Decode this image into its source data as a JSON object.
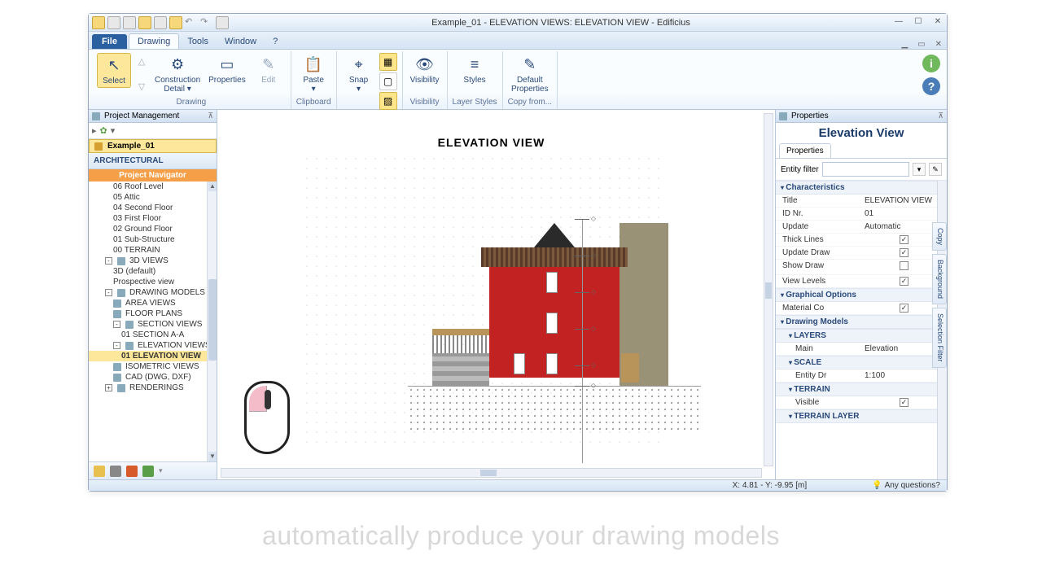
{
  "titlebar": {
    "text": "Example_01  -  ELEVATION VIEWS: ELEVATION VIEW - Edificius"
  },
  "menu": {
    "file": "File",
    "tabs": [
      "Drawing",
      "Tools",
      "Window",
      "?"
    ],
    "active": 0
  },
  "ribbon": {
    "groups": [
      {
        "label": "Drawing",
        "items": [
          {
            "label": "Select",
            "icon": "↖",
            "selected": true
          },
          {
            "label": "Construction\nDetail ▾",
            "icon": "⚙"
          },
          {
            "label": "Properties",
            "icon": "▭"
          },
          {
            "label": "Edit",
            "icon": "✎"
          }
        ]
      },
      {
        "label": "Clipboard",
        "items": [
          {
            "label": "Paste\n▾",
            "icon": "📋"
          }
        ]
      },
      {
        "label": "Snap",
        "items": [
          {
            "label": "Snap\n▾",
            "icon": "⌖"
          }
        ]
      },
      {
        "label": "Visibility",
        "items": [
          {
            "label": "Visibility",
            "icon": "👁"
          }
        ]
      },
      {
        "label": "Layer Styles",
        "items": [
          {
            "label": "Styles",
            "icon": "≡"
          }
        ]
      },
      {
        "label": "Copy from...",
        "items": [
          {
            "label": "Default\nProperties",
            "icon": "✎"
          }
        ]
      }
    ]
  },
  "projectPanel": {
    "title": "Project Management",
    "projectName": "Example_01",
    "sectionHeader": "ARCHITECTURAL",
    "navigatorHeader": "Project Navigator",
    "tree": [
      {
        "label": "06 Roof Level",
        "lvl": 1
      },
      {
        "label": "05 Attic",
        "lvl": 1
      },
      {
        "label": "04 Second Floor",
        "lvl": 1
      },
      {
        "label": "03 First Floor",
        "lvl": 1
      },
      {
        "label": "02 Ground Floor",
        "lvl": 1
      },
      {
        "label": "01 Sub-Structure",
        "lvl": 1
      },
      {
        "label": "00 TERRAIN",
        "lvl": 1
      },
      {
        "label": "3D VIEWS",
        "lvl": 0,
        "hdr": true,
        "exp": "-"
      },
      {
        "label": "3D (default)",
        "lvl": 1
      },
      {
        "label": "Prospective view",
        "lvl": 1
      },
      {
        "label": "DRAWING MODELS",
        "lvl": 0,
        "hdr": true,
        "exp": "-"
      },
      {
        "label": "AREA VIEWS",
        "lvl": 1,
        "hdr": true
      },
      {
        "label": "FLOOR PLANS",
        "lvl": 1,
        "hdr": true
      },
      {
        "label": "SECTION VIEWS",
        "lvl": 1,
        "hdr": true,
        "exp": "-"
      },
      {
        "label": "01 SECTION  A-A",
        "lvl": 2
      },
      {
        "label": "ELEVATION VIEWS",
        "lvl": 1,
        "hdr": true,
        "exp": "-"
      },
      {
        "label": "01 ELEVATION VIEW",
        "lvl": 2,
        "sel": true
      },
      {
        "label": "ISOMETRIC VIEWS",
        "lvl": 1,
        "hdr": true
      },
      {
        "label": "CAD (DWG, DXF)",
        "lvl": 1,
        "hdr": true
      },
      {
        "label": "RENDERINGS",
        "lvl": 0,
        "hdr": true,
        "exp": "+"
      }
    ]
  },
  "canvas": {
    "title": "ELEVATION VIEW"
  },
  "propsPanel": {
    "title": "Properties",
    "heading": "Elevation View",
    "tab": "Properties",
    "filterLabel": "Entity filter",
    "sections": [
      {
        "name": "Characteristics",
        "rows": [
          {
            "k": "Title",
            "v": "ELEVATION VIEW"
          },
          {
            "k": "ID Nr.",
            "v": "01"
          },
          {
            "k": "Update",
            "v": "Automatic"
          },
          {
            "k": "Thick Lines",
            "check": true
          },
          {
            "k": "Update Draw",
            "check": true
          },
          {
            "k": "Show Draw",
            "check": false
          },
          {
            "k": "View Levels",
            "check": true
          }
        ]
      },
      {
        "name": "Graphical Options",
        "rows": [
          {
            "k": "Material Co",
            "check": true
          }
        ]
      },
      {
        "name": "Drawing Models",
        "rows": []
      },
      {
        "name": "LAYERS",
        "sub": true,
        "rows": [
          {
            "k": "Main",
            "v": "Elevation"
          }
        ]
      },
      {
        "name": "SCALE",
        "sub": true,
        "rows": [
          {
            "k": "Entity Dr",
            "v": "1:100"
          }
        ]
      },
      {
        "name": "TERRAIN",
        "sub": true,
        "rows": [
          {
            "k": "Visible",
            "check": true
          }
        ]
      },
      {
        "name": "TERRAIN LAYER",
        "sub": true,
        "rows": []
      }
    ]
  },
  "sideTabs": [
    "Copy",
    "Background",
    "Selection Filter"
  ],
  "statusbar": {
    "coords": "X: 4.81 - Y: -9.95 [m]",
    "question": "Any questions?"
  },
  "caption": "automatically produce your drawing models"
}
